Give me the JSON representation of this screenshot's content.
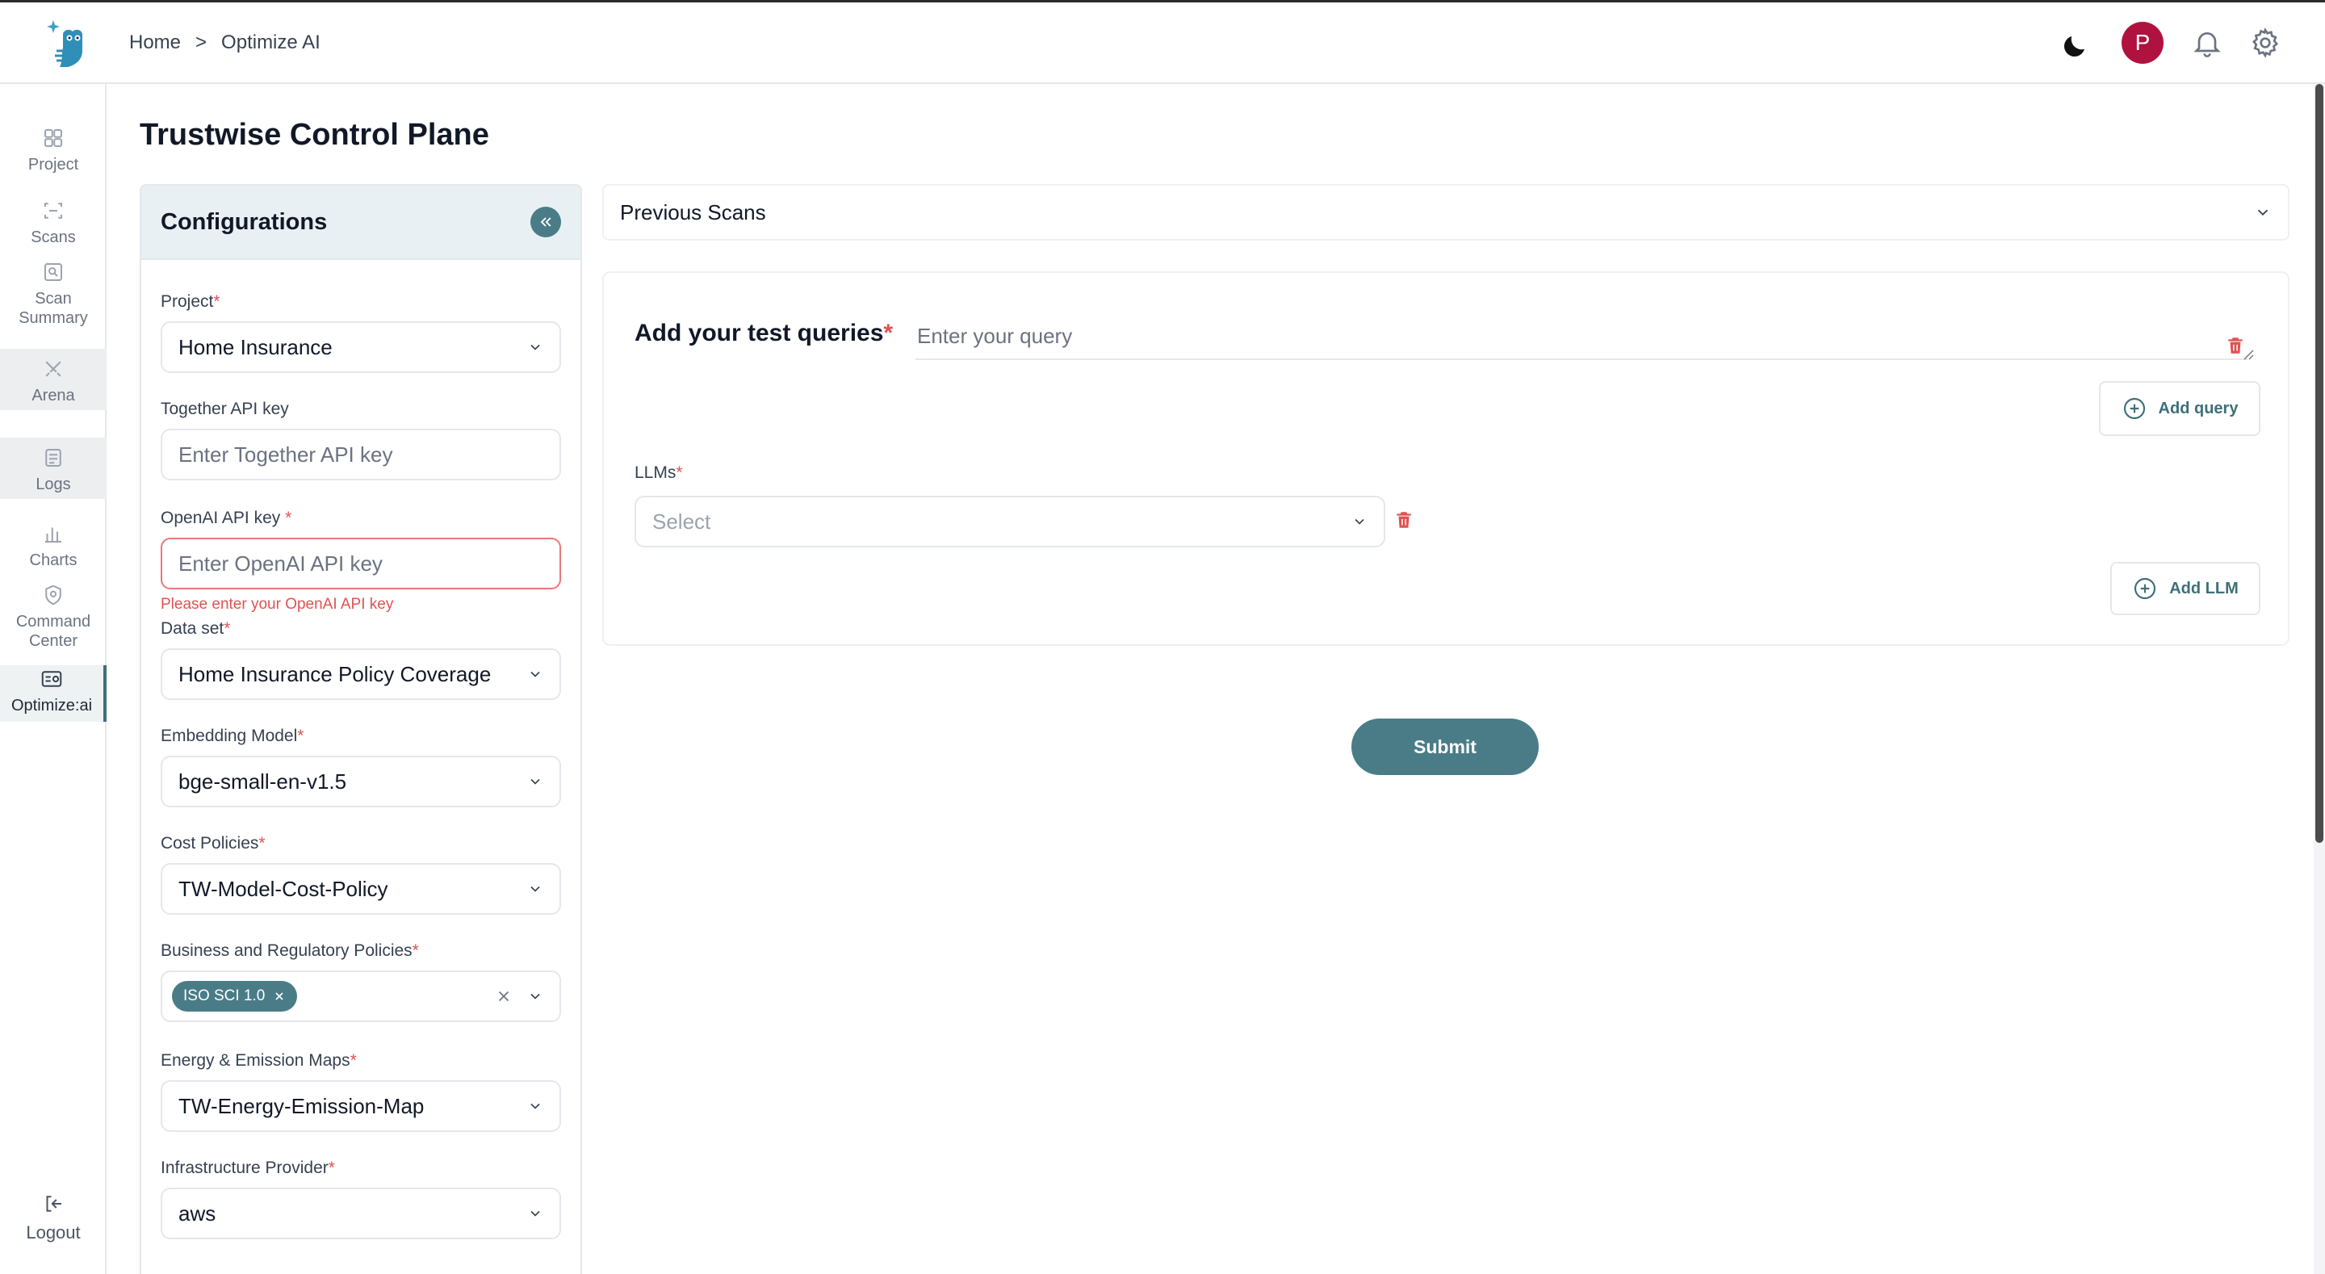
{
  "header": {
    "breadcrumb": [
      "Home",
      "Optimize AI"
    ],
    "breadcrumb_sep": ">",
    "avatar_initial": "P"
  },
  "sidebar": {
    "items": [
      {
        "label": "Project",
        "icon": "grid-icon"
      },
      {
        "label": "Scans",
        "icon": "scan-icon"
      },
      {
        "label": "Scan Summary",
        "icon": "scan-summary-icon"
      },
      {
        "label": "Arena",
        "icon": "swords-icon"
      },
      {
        "label": "Logs",
        "icon": "logs-icon"
      },
      {
        "label": "Charts",
        "icon": "bar-chart-icon"
      },
      {
        "label": "Command Center",
        "icon": "shield-icon"
      },
      {
        "label": "Optimize:ai",
        "icon": "optimize-icon"
      }
    ],
    "logout": "Logout"
  },
  "page": {
    "title": "Trustwise Control Plane"
  },
  "config": {
    "title": "Configurations",
    "project": {
      "label": "Project",
      "value": "Home Insurance"
    },
    "together": {
      "label": "Together API key",
      "placeholder": "Enter Together API key"
    },
    "openai": {
      "label": "OpenAI API key",
      "placeholder": "Enter OpenAI API key",
      "error": "Please enter your OpenAI API key"
    },
    "dataset": {
      "label": "Data set",
      "value": "Home Insurance Policy Coverage"
    },
    "embedding": {
      "label": "Embedding Model",
      "value": "bge-small-en-v1.5"
    },
    "cost": {
      "label": "Cost Policies",
      "value": "TW-Model-Cost-Policy"
    },
    "business": {
      "label": "Business and Regulatory Policies",
      "tag": "ISO SCI 1.0"
    },
    "energy": {
      "label": "Energy & Emission Maps",
      "value": "TW-Energy-Emission-Map"
    },
    "infra": {
      "label": "Infrastructure Provider",
      "value": "aws"
    }
  },
  "main": {
    "previous_scans": "Previous Scans",
    "queries_label": "Add your test queries",
    "query_placeholder": "Enter your query",
    "add_query": "Add query",
    "llms_label": "LLMs",
    "llm_placeholder": "Select",
    "add_llm": "Add LLM",
    "submit": "Submit"
  },
  "colors": {
    "accent": "#4a7c88",
    "error": "#e05252",
    "avatar": "#b0123f"
  }
}
